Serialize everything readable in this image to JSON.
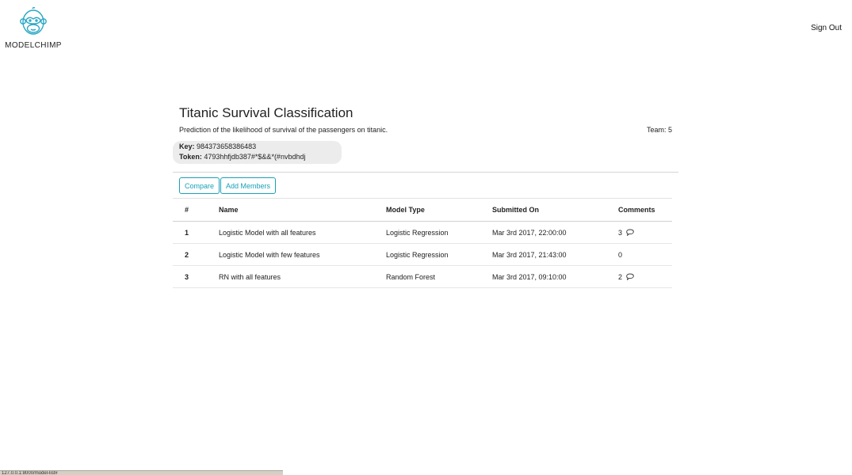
{
  "header": {
    "brand": "MODELCHIMP",
    "sign_out": "Sign Out"
  },
  "project": {
    "title": "Titanic Survival Classification",
    "description": "Prediction of the likelihood of survival of the passengers on titanic.",
    "team": "Team: 5",
    "key_label": "Key:",
    "key_value": "984373658386483",
    "token_label": "Token:",
    "token_value": "4793hhfjdb387#*$&&*(#nvbdhdj"
  },
  "actions": {
    "compare": "Compare",
    "add_members": "Add Members"
  },
  "table": {
    "columns": [
      "#",
      "Name",
      "Model Type",
      "Submitted On",
      "Comments"
    ],
    "rows": [
      {
        "num": "1",
        "name": "Logistic Model with all features",
        "type": "Logistic Regression",
        "date": "Mar 3rd 2017, 22:00:00",
        "comments": "3"
      },
      {
        "num": "2",
        "name": "Logistic Model with few features",
        "type": "Logistic Regression",
        "date": "Mar 3rd 2017, 21:43:00",
        "comments": "0"
      },
      {
        "num": "3",
        "name": "RN with all features",
        "type": "Random Forest",
        "date": "Mar 3rd 2017, 09:10:00",
        "comments": "2"
      }
    ]
  },
  "statusbar": {
    "url": "127.0.0.1:8000/model-list#"
  },
  "colors": {
    "accent": "#17a2b8",
    "logo": "#2aa7c4"
  },
  "icons": {
    "logo": "chimp-logo-icon",
    "comment": "speech-bubble-icon"
  }
}
